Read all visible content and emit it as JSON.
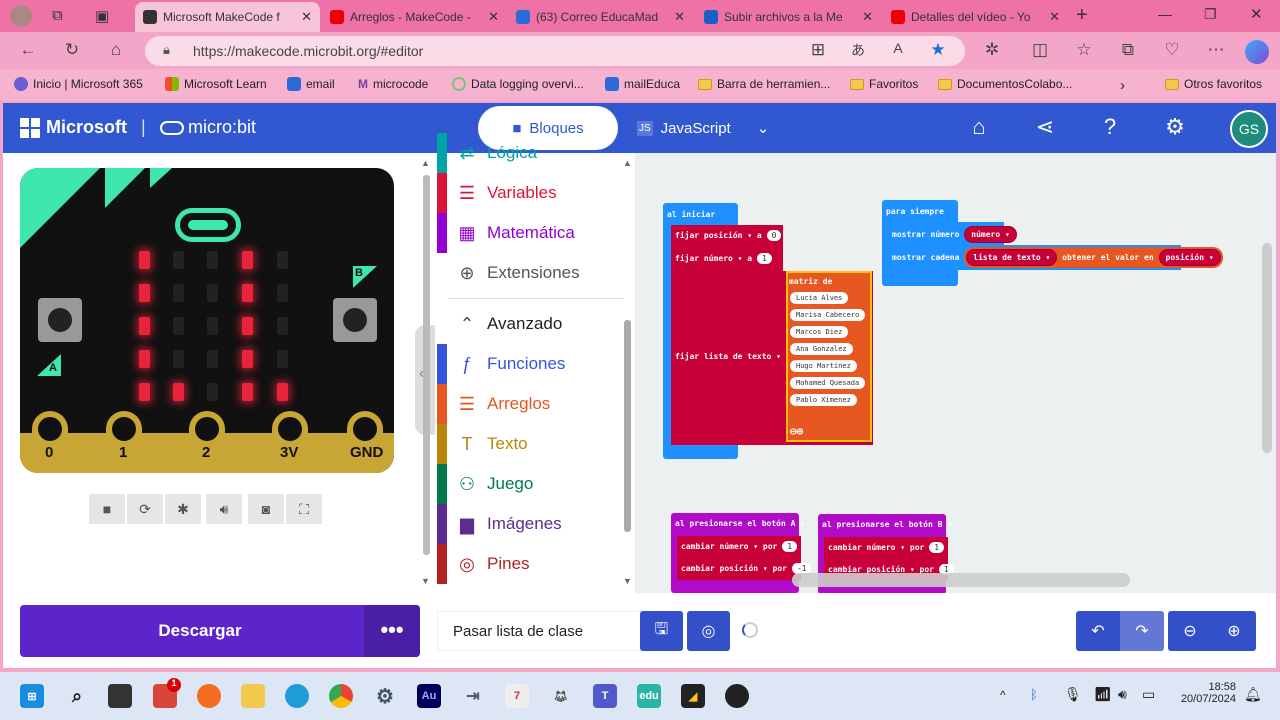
{
  "browser": {
    "tabs": [
      {
        "title": "Microsoft MakeCode f",
        "active": true,
        "icon": "makecode-icon",
        "color": "#333"
      },
      {
        "title": "Arreglos - MakeCode -",
        "icon": "youtube-icon",
        "color": "#e00"
      },
      {
        "title": "(63) Correo EducaMad",
        "icon": "mail-icon",
        "color": "#2a6bd6"
      },
      {
        "title": "Subir archivos a la Me",
        "icon": "docs-icon",
        "color": "#1a5fc8"
      },
      {
        "title": "Detalles del vídeo - Yo",
        "icon": "youtube-icon",
        "color": "#e00"
      }
    ],
    "url": "https://makecode.microbit.org/#editor",
    "bookmarks": [
      "Inicio | Microsoft 365",
      "Microsoft Learn",
      "email",
      "microcode",
      "Data logging overvi...",
      "mailEduca",
      "Barra de herramien...",
      "Favoritos",
      "DocumentosColabo...",
      "Otros favoritos"
    ]
  },
  "header": {
    "brand": "Microsoft",
    "product": "micro:bit",
    "mode_blocks": "Bloques",
    "mode_js": "JavaScript",
    "avatar": "GS"
  },
  "simulator": {
    "leds": [
      [
        1,
        0,
        0,
        1,
        0
      ],
      [
        1,
        0,
        0,
        1,
        0
      ],
      [
        1,
        0,
        0,
        1,
        0
      ],
      [
        1,
        0,
        0,
        1,
        0
      ],
      [
        1,
        1,
        0,
        1,
        1
      ]
    ],
    "pins": [
      "0",
      "1",
      "2",
      "3V",
      "GND"
    ],
    "button_a": "A",
    "button_b": "B"
  },
  "toolbox": {
    "categories": [
      {
        "label": "Lógica",
        "color": "#00a4a6",
        "icon": "logic-icon"
      },
      {
        "label": "Variables",
        "color": "#dc143c",
        "icon": "list-icon"
      },
      {
        "label": "Matemática",
        "color": "#9400d3",
        "icon": "calculator-icon"
      },
      {
        "label": "Extensiones",
        "color": "#777777",
        "icon": "plus-icon"
      },
      {
        "label": "Avanzado",
        "color": "#222222",
        "icon": "chevron-up-icon"
      },
      {
        "label": "Funciones",
        "color": "#3455db",
        "icon": "function-icon"
      },
      {
        "label": "Arreglos",
        "color": "#e65722",
        "icon": "list-icon"
      },
      {
        "label": "Texto",
        "color": "#b8860b",
        "icon": "text-icon"
      },
      {
        "label": "Juego",
        "color": "#007a4b",
        "icon": "gamepad-icon"
      },
      {
        "label": "Imágenes",
        "color": "#5c2d91",
        "icon": "image-icon"
      },
      {
        "label": "Pines",
        "color": "#b22222",
        "icon": "pin-icon"
      }
    ]
  },
  "workspace": {
    "on_start": {
      "label": "al iniciar",
      "set": "fijar",
      "a": "a",
      "var_pos": "posición ▾",
      "val_pos": "0",
      "var_num": "número ▾",
      "val_num": "1",
      "var_list": "lista de texto ▾",
      "array_label": "matriz de",
      "items": [
        "Lucia Alves",
        "Marisa Cabecero",
        "Marcos Diez",
        "Ana Gonzalez",
        "Hugo Martinez",
        "Mohamed Quesada",
        "Pablo Ximenez"
      ]
    },
    "forever": {
      "label": "para siempre",
      "show_number": "mostrar número",
      "num_var": "número ▾",
      "show_string": "mostrar cadena",
      "list_var": "lista de texto ▾",
      "get_value": "obtener el valor en",
      "pos_var": "posición ▾"
    },
    "button_a": {
      "label": "al presionarse el botón",
      "btn": "A ▾",
      "change": "cambiar",
      "por": "por",
      "num_var": "número ▾",
      "num_val": "1",
      "pos_var": "posición ▾",
      "pos_val": "-1"
    },
    "button_b": {
      "label": "al presionarse el botón",
      "btn": "B ▾",
      "change": "cambiar",
      "por": "por",
      "num_var": "número ▾",
      "num_val": "1",
      "pos_var": "posición ▾",
      "pos_val": "1"
    }
  },
  "bottom": {
    "download": "Descargar",
    "project_name": "Pasar lista de clase"
  },
  "taskbar": {
    "time": "18:58",
    "date": "20/07/2024",
    "badge": "1"
  }
}
